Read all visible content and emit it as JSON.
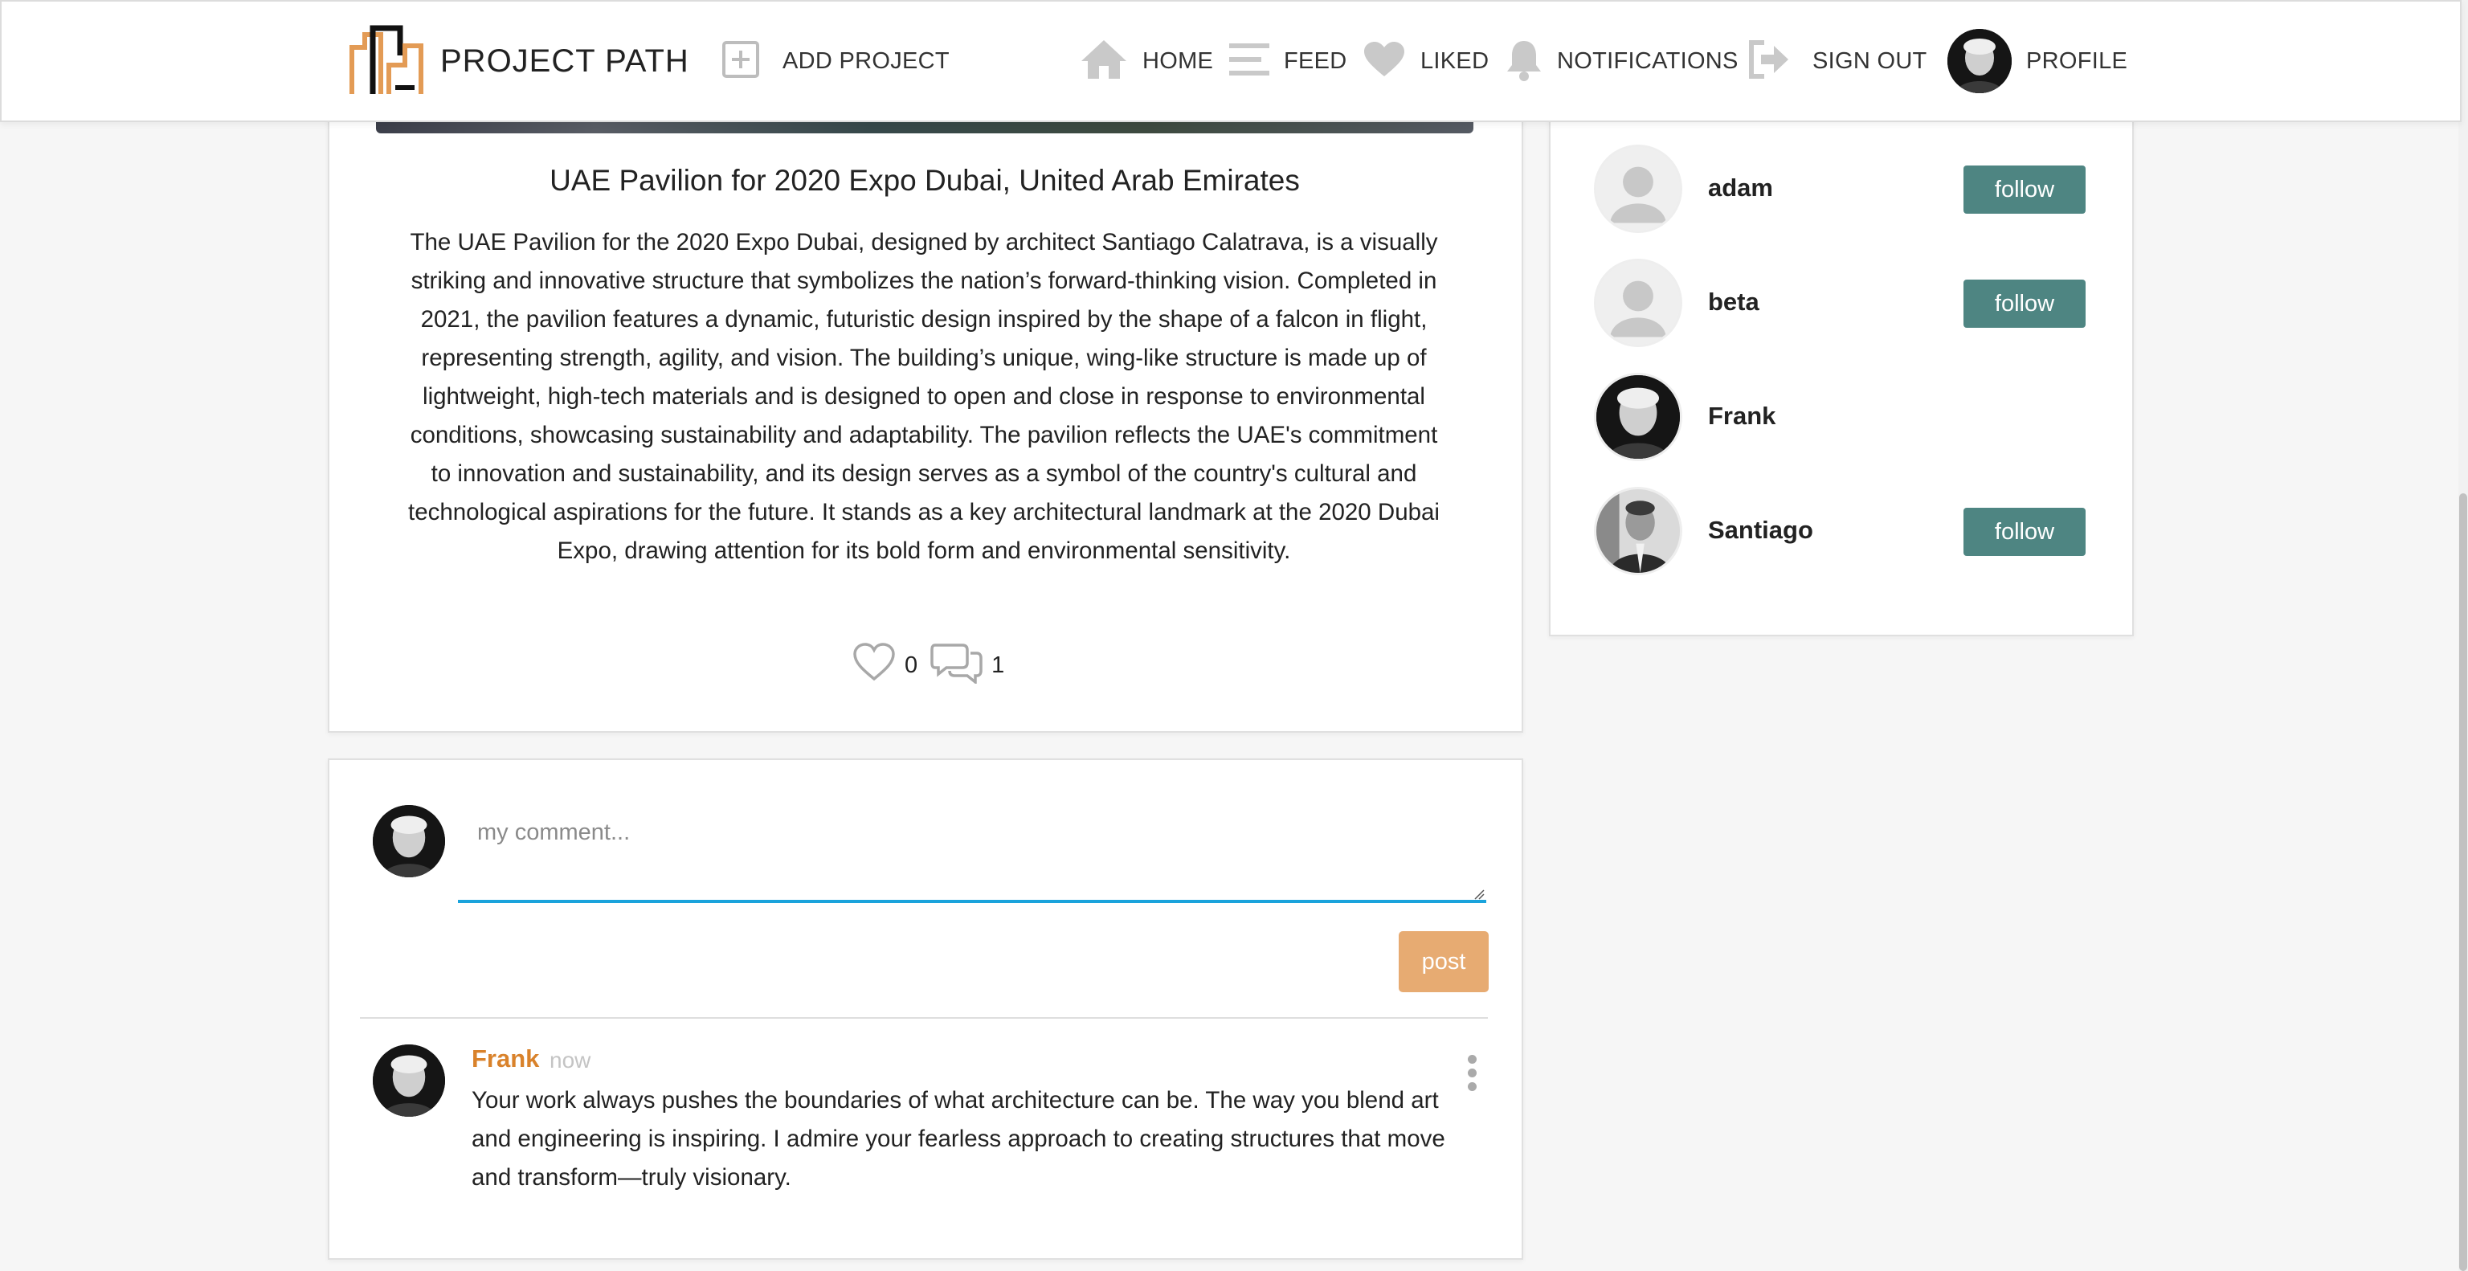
{
  "navbar": {
    "logo_text": "PROJECT PATH",
    "add_project": "ADD PROJECT",
    "home": "HOME",
    "feed": "FEED",
    "liked": "LIKED",
    "notifications": "NOTIFICATIONS",
    "sign_out": "SIGN OUT",
    "profile": "PROFILE",
    "icons": [
      "logo-icon",
      "add-project-icon",
      "home-icon",
      "feed-icon",
      "heart-icon",
      "bell-icon",
      "sign-out-icon"
    ]
  },
  "post": {
    "title": "UAE Pavilion for 2020 Expo Dubai, United Arab Emirates",
    "description": "The UAE Pavilion for the 2020 Expo Dubai, designed by architect Santiago Calatrava, is a visually striking and innovative structure that symbolizes the nation’s forward-thinking vision. Completed in 2021, the pavilion features a dynamic, futuristic design inspired by the shape of a falcon in flight, representing strength, agility, and vision. The building’s unique, wing-like structure is made up of lightweight, high-tech materials and is designed to open and close in response to environmental conditions, showcasing sustainability and adaptability. The pavilion reflects the UAE's commitment to innovation and sustainability, and its design serves as a symbol of the country's cultural and technological aspirations for the future. It stands as a key architectural landmark at the 2020 Dubai Expo, drawing attention for its bold form and environmental sensitivity.",
    "likes": "0",
    "comments": "1"
  },
  "comment_form": {
    "placeholder": "my comment...",
    "post_label": "post"
  },
  "comments": [
    {
      "author": "Frank",
      "time": "now",
      "text": "Your work always pushes the boundaries of what architecture can be. The way you blend art and engineering is inspiring. I admire your fearless approach to creating structures that move and transform—truly visionary."
    }
  ],
  "suggestions": [
    {
      "name": "adam",
      "follow_label": "follow"
    },
    {
      "name": "beta",
      "follow_label": "follow"
    },
    {
      "name": "Frank"
    },
    {
      "name": "Santiago",
      "follow_label": "follow"
    }
  ],
  "colors": {
    "accent_orange": "#d9822b",
    "post_button": "#e7ab72",
    "follow_button": "#4e8582",
    "input_focus": "#1aa3dc"
  }
}
